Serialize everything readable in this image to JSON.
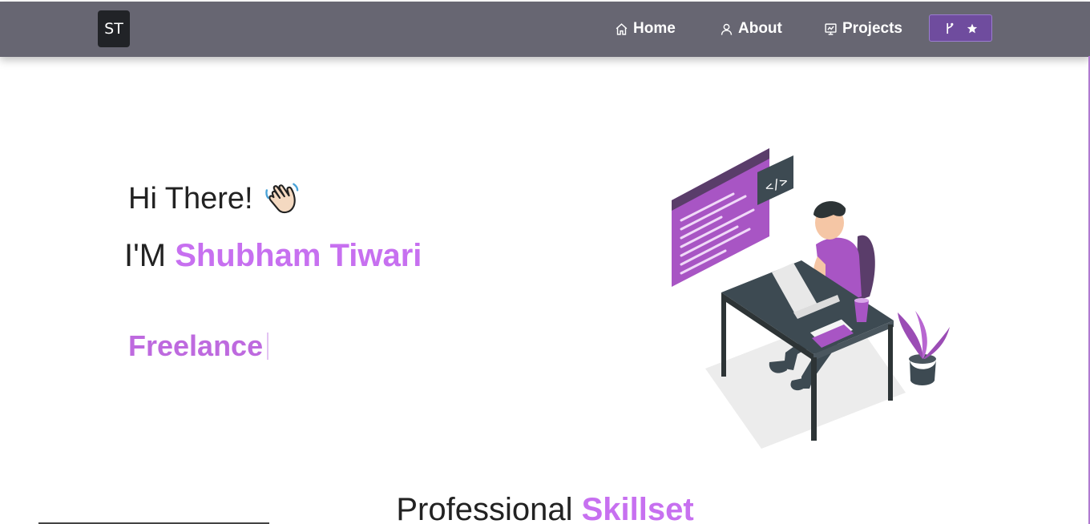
{
  "nav": {
    "logo": "ST",
    "items": [
      {
        "label": "Home",
        "icon": "home-icon"
      },
      {
        "label": "About",
        "icon": "user-icon"
      },
      {
        "label": "Projects",
        "icon": "projects-icon"
      }
    ],
    "github_button": {
      "icons": [
        "git-fork-icon",
        "star-icon"
      ]
    }
  },
  "hero": {
    "greeting": "Hi There!",
    "name_prefix": "I'M ",
    "name": "Shubham Tiwari",
    "typed_text": "Freelance"
  },
  "skills_section": {
    "title_prefix": "Professional ",
    "title_accent": "Skillset"
  },
  "colors": {
    "navbar": "#676672",
    "accent": "#c770f0",
    "button": "#6f4c9e"
  }
}
